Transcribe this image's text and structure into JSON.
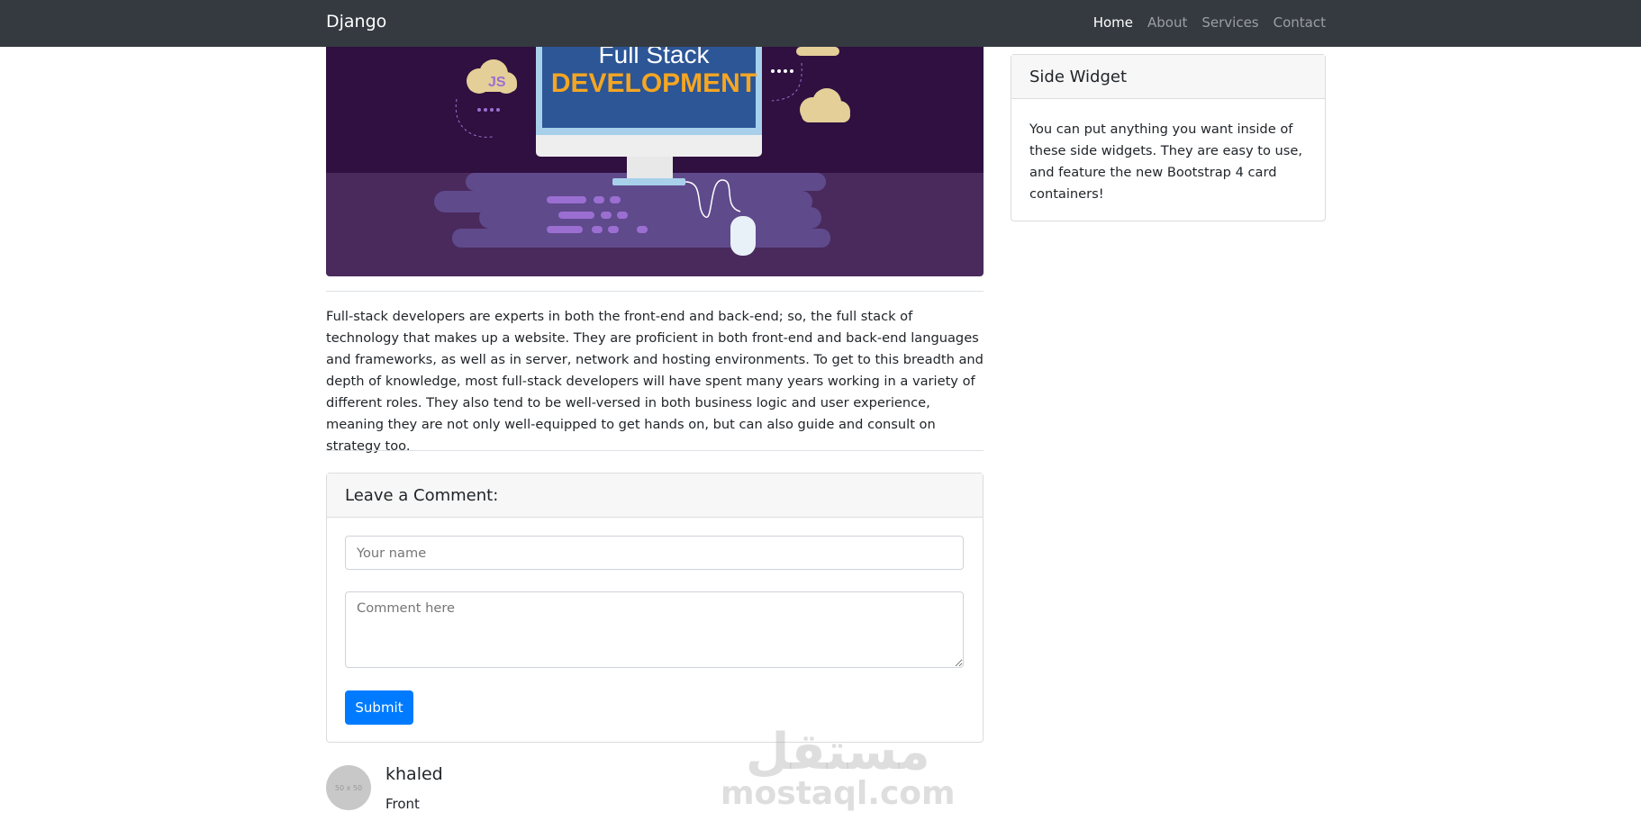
{
  "navbar": {
    "brand": "Django",
    "links": [
      {
        "label": "Home",
        "active": true
      },
      {
        "label": "About"
      },
      {
        "label": "Services"
      },
      {
        "label": "Contact"
      }
    ]
  },
  "hero": {
    "line1": "Full Stack",
    "line2": "DEVELOPMENT",
    "badge": "JS"
  },
  "post": {
    "body": "Full-stack developers are experts in both the front-end and back-end; so, the full stack of technology that makes up a website. They are proficient in both front-end and back-end languages and frameworks, as well as in server, network and hosting environments. To get to this breadth and depth of knowledge, most full-stack developers will have spent many years working in a variety of different roles. They also tend to be well-versed in both business logic and user experience, meaning they are not only well-equipped to get hands on, but can also guide and consult on strategy too."
  },
  "comment_form": {
    "title": "Leave a Comment:",
    "name_placeholder": "Your name",
    "comment_placeholder": "Comment here",
    "submit_label": "Submit"
  },
  "comments": [
    {
      "avatar_text": "50 x 50",
      "name": "khaled",
      "text": "Front"
    }
  ],
  "sidebar": {
    "title": "Side Widget",
    "body": "You can put anything you want inside of these side widgets. They are easy to use, and feature the new Bootstrap 4 card containers!"
  },
  "watermark": {
    "arabic": "مستقل",
    "latin": "mostaql.com"
  },
  "colors": {
    "navbar": "#343a40",
    "primary": "#007bff",
    "hero_dark": "#2f1040",
    "hero_light": "#4a2a5c"
  }
}
